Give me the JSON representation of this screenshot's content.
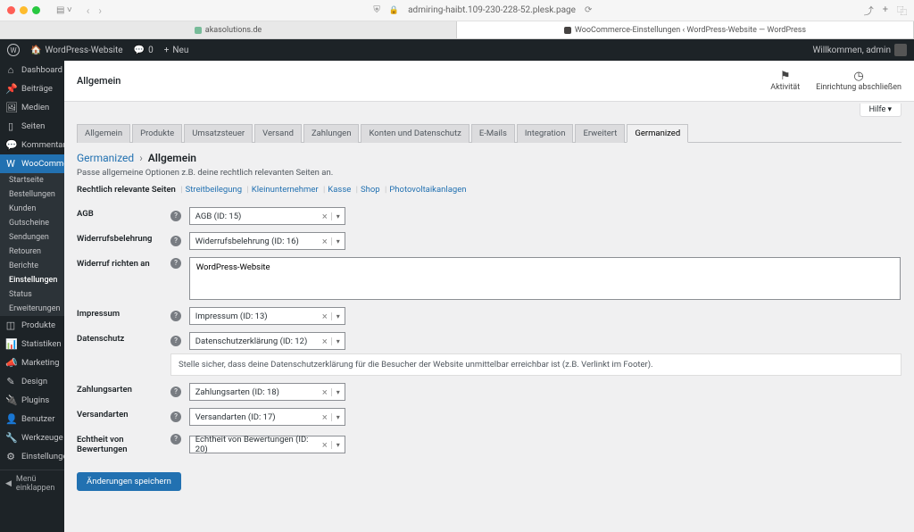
{
  "browser": {
    "url": "admiring-haibt.109-230-228-52.plesk.page",
    "tabs": [
      {
        "label": "akasolutions.de",
        "active": false
      },
      {
        "label": "WooCommerce-Einstellungen ‹ WordPress-Website — WordPress",
        "active": true
      }
    ]
  },
  "adminbar": {
    "site_name": "WordPress-Website",
    "comments_count": "0",
    "new_label": "Neu",
    "greeting": "Willkommen, admin"
  },
  "sidebar": {
    "items": [
      {
        "icon": "⌂",
        "label": "Dashboard"
      },
      {
        "icon": "📌",
        "label": "Beiträge"
      },
      {
        "icon": "🖼",
        "label": "Medien"
      },
      {
        "icon": "▯",
        "label": "Seiten"
      },
      {
        "icon": "💬",
        "label": "Kommentare"
      },
      {
        "icon": "W",
        "label": "WooCommerce",
        "current": true
      },
      {
        "icon": "◫",
        "label": "Produkte"
      },
      {
        "icon": "📊",
        "label": "Statistiken"
      },
      {
        "icon": "📣",
        "label": "Marketing"
      },
      {
        "icon": "✎",
        "label": "Design"
      },
      {
        "icon": "🔌",
        "label": "Plugins"
      },
      {
        "icon": "👤",
        "label": "Benutzer"
      },
      {
        "icon": "🔧",
        "label": "Werkzeuge"
      },
      {
        "icon": "⚙",
        "label": "Einstellungen"
      }
    ],
    "submenu": [
      "Startseite",
      "Bestellungen",
      "Kunden",
      "Gutscheine",
      "Sendungen",
      "Retouren",
      "Berichte",
      "Einstellungen",
      "Status",
      "Erweiterungen"
    ],
    "submenu_current": "Einstellungen",
    "collapse_label": "Menü einklappen"
  },
  "header": {
    "title": "Allgemein",
    "activity": "Aktivität",
    "finish_setup": "Einrichtung abschließen",
    "help": "Hilfe"
  },
  "tabs": [
    "Allgemein",
    "Produkte",
    "Umsatzsteuer",
    "Versand",
    "Zahlungen",
    "Konten und Datenschutz",
    "E-Mails",
    "Integration",
    "Erweitert",
    "Germanized"
  ],
  "tabs_active": "Germanized",
  "breadcrumb": {
    "parent": "Germanized",
    "current": "Allgemein"
  },
  "description": "Passe allgemeine Optionen z.B. deine rechtlich relevanten Seiten an.",
  "section_links": {
    "label": "Rechtlich relevante Seiten",
    "links": [
      "Streitbeilegung",
      "Kleinunternehmer",
      "Kasse",
      "Shop",
      "Photovoltaikanlagen"
    ]
  },
  "form": {
    "agb": {
      "label": "AGB",
      "value": "AGB (ID: 15)"
    },
    "widerruf": {
      "label": "Widerrufsbelehrung",
      "value": "Widerrufsbelehrung (ID: 16)"
    },
    "widerruf_richten": {
      "label": "Widerruf richten an",
      "value": "WordPress-Website"
    },
    "impressum": {
      "label": "Impressum",
      "value": "Impressum (ID: 13)"
    },
    "datenschutz": {
      "label": "Datenschutz",
      "value": "Datenschutzerklärung (ID: 12)",
      "note": "Stelle sicher, dass deine Datenschutzerklärung für die Besucher der Website unmittelbar erreichbar ist (z.B. Verlinkt im Footer)."
    },
    "zahlungsarten": {
      "label": "Zahlungsarten",
      "value": "Zahlungsarten (ID: 18)"
    },
    "versandarten": {
      "label": "Versandarten",
      "value": "Versandarten (ID: 17)"
    },
    "echtheit": {
      "label": "Echtheit von Bewertungen",
      "value": "Echtheit von Bewertungen (ID: 20)"
    }
  },
  "submit_label": "Änderungen speichern"
}
